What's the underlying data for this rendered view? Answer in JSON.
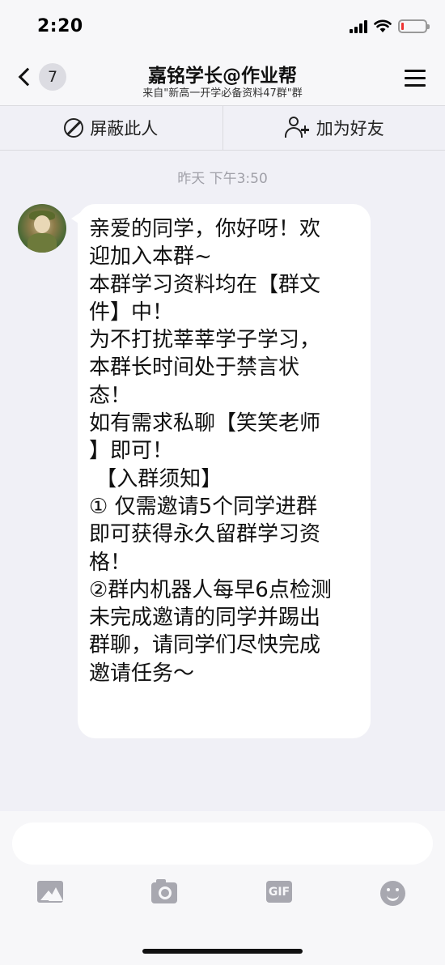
{
  "status_bar": {
    "time": "2:20",
    "battery_level": 0.1
  },
  "nav": {
    "back_badge": "7",
    "title": "嘉铭学长@作业帮",
    "subtitle": "来自\"新高一开学必备资料47群\"群"
  },
  "actions": {
    "block_label": "屏蔽此人",
    "add_friend_label": "加为好友"
  },
  "chat": {
    "timestamp": "昨天 下午3:50",
    "message": "亲爱的同学，你好呀！欢\n迎加入本群~\n本群学习资料均在【群文\n件】中！\n为不打扰莘莘学子学习，\n本群长时间处于禁言状\n态！\n如有需求私聊【笑笑老师\n】即可！\n 【入群须知】\n① 仅需邀请5个同学进群\n即可获得永久留群学习资\n格！\n②群内机器人每早6点检测\n未完成邀请的同学并踢出\n群聊，请同学们尽快完成\n邀请任务～"
  },
  "input": {
    "placeholder": "",
    "gif_label": "GIF"
  },
  "colors": {
    "background": "#f0f0f6",
    "bubble": "#ffffff",
    "toolbar_icon": "#a8a8b0"
  }
}
